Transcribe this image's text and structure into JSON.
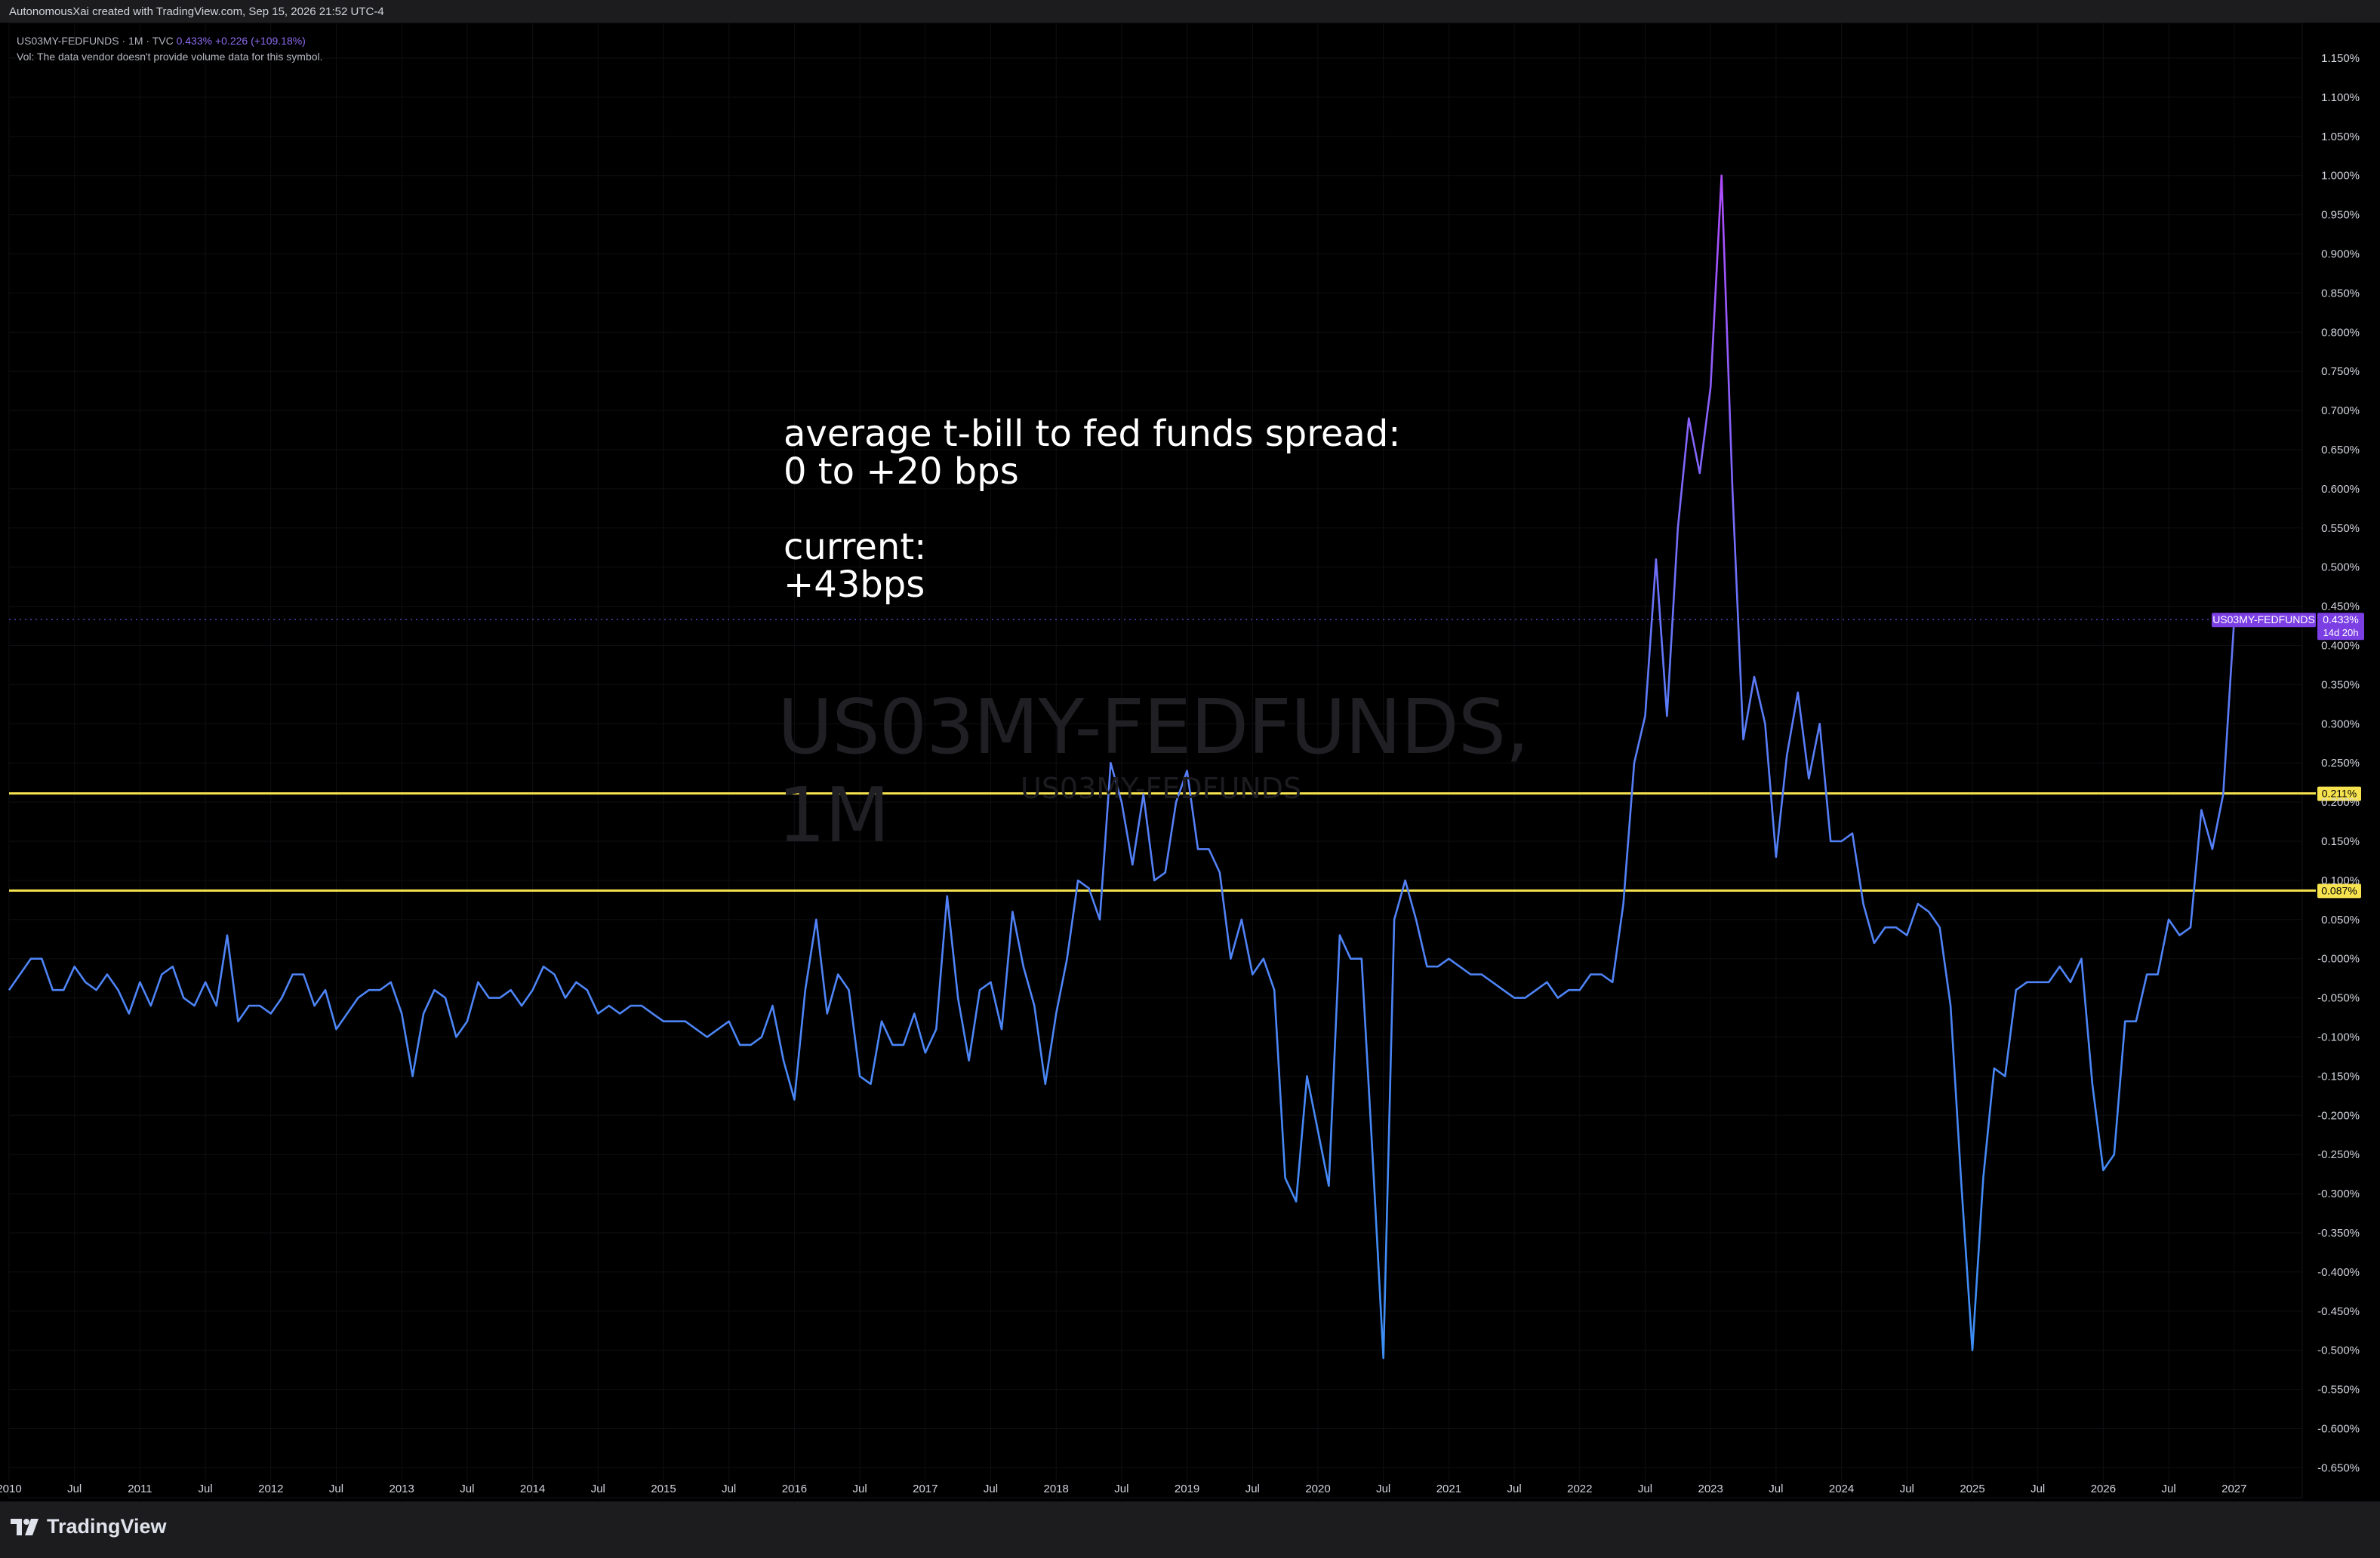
{
  "header": {
    "title": "AutonomousXai created with TradingView.com, Sep 15, 2026 21:52 UTC-4"
  },
  "legend": {
    "symbol": "US03MY-FEDFUNDS · 1M · TVC",
    "last": "0.433%",
    "change": "+0.226 (+109.18%)",
    "volume_note": "Vol: The data vendor doesn't provide volume data for this symbol."
  },
  "annotation": {
    "text": "average t-bill to fed funds spread:\n0 to +20 bps\n\ncurrent:\n+43bps"
  },
  "watermark": {
    "main": "US03MY-FEDFUNDS, 1M",
    "sub": "US03MY-FEDFUNDS"
  },
  "series_label": {
    "name": "US03MY-FEDFUNDS",
    "value": "0.433%",
    "countdown": "14d 20h"
  },
  "hlines": [
    {
      "value": 0.211,
      "label": "0.211%"
    },
    {
      "value": 0.087,
      "label": "0.087%"
    }
  ],
  "brand": {
    "name": "TradingView"
  },
  "colors": {
    "background": "#000000",
    "line_blue": "#3d8ff5",
    "line_purple": "#b04cff",
    "hline": "#f7e34f",
    "label_bg": "#7b3fe4",
    "axis_text": "#d1d4dc"
  },
  "chart_data": {
    "type": "line",
    "y_axis_ticks": [
      "1.150%",
      "1.100%",
      "1.050%",
      "1.000%",
      "0.950%",
      "0.900%",
      "0.850%",
      "0.800%",
      "0.750%",
      "0.700%",
      "0.650%",
      "0.600%",
      "0.550%",
      "0.500%",
      "0.450%",
      "0.400%",
      "0.350%",
      "0.300%",
      "0.250%",
      "0.200%",
      "0.150%",
      "0.100%",
      "0.050%",
      "-0.000%",
      "-0.050%",
      "-0.100%",
      "-0.150%",
      "-0.200%",
      "-0.250%",
      "-0.300%",
      "-0.350%",
      "-0.400%",
      "-0.450%",
      "-0.500%",
      "-0.550%",
      "-0.600%",
      "-0.650%"
    ],
    "ylim": [
      -0.655,
      1.165
    ],
    "x_axis_ticks": [
      "2010",
      "Jul",
      "2011",
      "Jul",
      "2012",
      "Jul",
      "2013",
      "Jul",
      "2014",
      "Jul",
      "2015",
      "Jul",
      "2016",
      "Jul",
      "2017",
      "Jul",
      "2018",
      "Jul",
      "2019",
      "Jul",
      "2020",
      "Jul",
      "2021",
      "Jul",
      "2022",
      "Jul",
      "2023",
      "Jul",
      "2024",
      "Jul",
      "2025",
      "Jul",
      "2026",
      "Jul",
      "2027"
    ],
    "xlim": [
      "2010-01",
      "2027-06"
    ],
    "start": "2010-01",
    "frequency": "monthly",
    "values": [
      -0.04,
      -0.02,
      0.0,
      0.0,
      -0.04,
      -0.04,
      -0.01,
      -0.03,
      -0.04,
      -0.02,
      -0.04,
      -0.07,
      -0.03,
      -0.06,
      -0.02,
      -0.01,
      -0.05,
      -0.06,
      -0.03,
      -0.06,
      0.03,
      -0.08,
      -0.06,
      -0.06,
      -0.07,
      -0.05,
      -0.02,
      -0.02,
      -0.06,
      -0.04,
      -0.09,
      -0.07,
      -0.05,
      -0.04,
      -0.04,
      -0.03,
      -0.07,
      -0.15,
      -0.07,
      -0.04,
      -0.05,
      -0.1,
      -0.08,
      -0.03,
      -0.05,
      -0.05,
      -0.04,
      -0.06,
      -0.04,
      -0.01,
      -0.02,
      -0.05,
      -0.03,
      -0.04,
      -0.07,
      -0.06,
      -0.07,
      -0.06,
      -0.06,
      -0.07,
      -0.08,
      -0.08,
      -0.08,
      -0.09,
      -0.1,
      -0.09,
      -0.08,
      -0.11,
      -0.11,
      -0.1,
      -0.06,
      -0.13,
      -0.18,
      -0.04,
      0.05,
      -0.07,
      -0.02,
      -0.04,
      -0.15,
      -0.16,
      -0.08,
      -0.11,
      -0.11,
      -0.07,
      -0.12,
      -0.09,
      0.08,
      -0.05,
      -0.13,
      -0.04,
      -0.03,
      -0.09,
      0.06,
      -0.01,
      -0.06,
      -0.16,
      -0.07,
      0.0,
      0.1,
      0.09,
      0.05,
      0.25,
      0.2,
      0.12,
      0.21,
      0.1,
      0.11,
      0.2,
      0.24,
      0.14,
      0.14,
      0.11,
      0.0,
      0.05,
      -0.02,
      0.0,
      -0.04,
      -0.28,
      -0.31,
      -0.15,
      -0.22,
      -0.29,
      0.03,
      0.0,
      0.0,
      -0.25,
      -0.51,
      0.05,
      0.1,
      0.05,
      -0.01,
      -0.01,
      0.0,
      -0.01,
      -0.02,
      -0.02,
      -0.03,
      -0.04,
      -0.05,
      -0.05,
      -0.04,
      -0.03,
      -0.05,
      -0.04,
      -0.04,
      -0.02,
      -0.02,
      -0.03,
      0.07,
      0.25,
      0.31,
      0.51,
      0.31,
      0.55,
      0.69,
      0.62,
      0.73,
      1.0,
      0.6,
      0.28,
      0.36,
      0.3,
      0.13,
      0.26,
      0.34,
      0.23,
      0.3,
      0.15,
      0.15,
      0.16,
      0.07,
      0.02,
      0.04,
      0.04,
      0.03,
      0.07,
      0.06,
      0.04,
      -0.06,
      -0.29,
      -0.5,
      -0.28,
      -0.14,
      -0.15,
      -0.04,
      -0.03,
      -0.03,
      -0.03,
      -0.01,
      -0.03,
      0.0,
      -0.16,
      -0.27,
      -0.25,
      -0.08,
      -0.08,
      -0.02,
      -0.02,
      0.05,
      0.03,
      0.04,
      0.19,
      0.14,
      0.21,
      0.433
    ]
  }
}
